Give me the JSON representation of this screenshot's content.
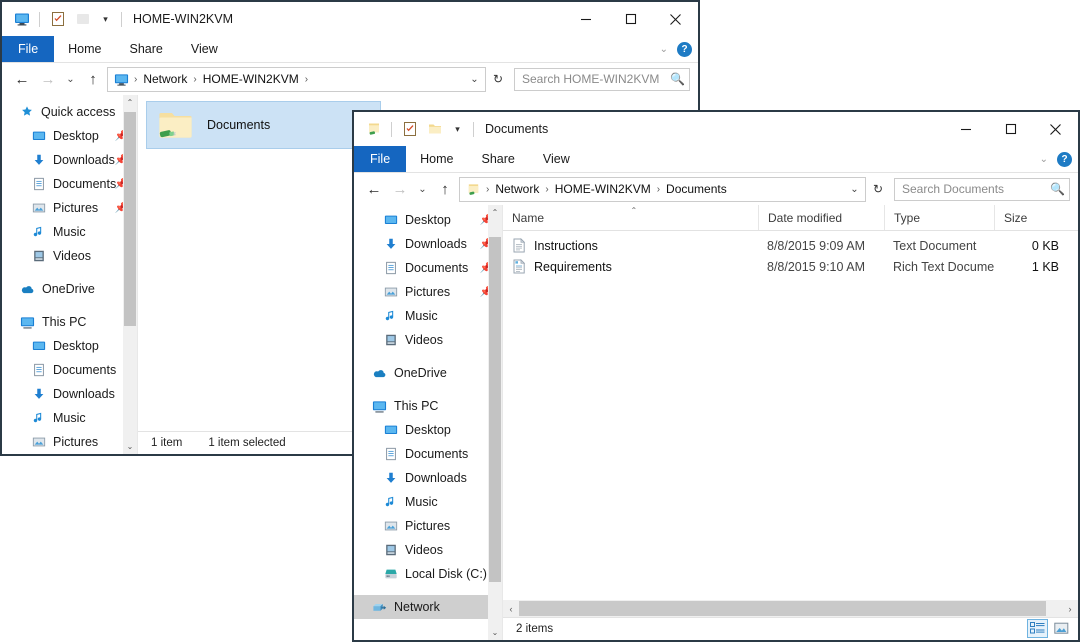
{
  "desktop": {
    "background_color": "#ffffff"
  },
  "windows": [
    {
      "id": "window-network-home",
      "title": "HOME-WIN2KVM",
      "quick_access_toolbar": {
        "computer_icon": "monitor-icon",
        "properties_icon": "properties-checklist-icon",
        "newfolder_icon": "new-folder-icon",
        "customize_icon": "chevron-down-icon"
      },
      "caption": {
        "minimize": "–",
        "maximize": "□",
        "close": "✕"
      },
      "ribbon": {
        "tabs": [
          "File",
          "Home",
          "Share",
          "View"
        ],
        "collapse_icon": "chevron-down-icon",
        "help_icon": "help-icon",
        "help_label": "?"
      },
      "address": {
        "back_icon": "arrow-left-icon",
        "forward_icon": "arrow-right-icon",
        "recent_icon": "chevron-down-icon",
        "up_icon": "arrow-up-icon",
        "root_icon": "monitor-icon",
        "crumbs": [
          "Network",
          "HOME-WIN2KVM"
        ],
        "trailing_separator": "›",
        "dropdown_icon": "chevron-down-icon",
        "refresh_icon": "refresh-icon",
        "refresh_label": "↻"
      },
      "search": {
        "placeholder": "Search HOME-WIN2KVM",
        "icon": "search-icon"
      },
      "nav_pane": {
        "groups": [
          {
            "header": {
              "label": "Quick access",
              "icon": "star-pin-icon"
            },
            "items": [
              {
                "label": "Desktop",
                "icon": "desktop-icon",
                "pinned": true
              },
              {
                "label": "Downloads",
                "icon": "downloads-icon",
                "pinned": true
              },
              {
                "label": "Documents",
                "icon": "documents-icon",
                "pinned": true
              },
              {
                "label": "Pictures",
                "icon": "pictures-icon",
                "pinned": true
              },
              {
                "label": "Music",
                "icon": "music-icon",
                "pinned": false
              },
              {
                "label": "Videos",
                "icon": "videos-icon",
                "pinned": false
              }
            ]
          },
          {
            "header": {
              "label": "OneDrive",
              "icon": "onedrive-cloud-icon"
            },
            "items": []
          },
          {
            "header": {
              "label": "This PC",
              "icon": "thispc-monitor-icon"
            },
            "items": [
              {
                "label": "Desktop",
                "icon": "desktop-icon",
                "pinned": false
              },
              {
                "label": "Documents",
                "icon": "documents-icon",
                "pinned": false
              },
              {
                "label": "Downloads",
                "icon": "downloads-icon",
                "pinned": false
              },
              {
                "label": "Music",
                "icon": "music-icon",
                "pinned": false
              },
              {
                "label": "Pictures",
                "icon": "pictures-icon",
                "pinned": false
              }
            ]
          }
        ],
        "scroll_up_icon": "chevron-up-icon",
        "scroll_down_icon": "chevron-down-icon"
      },
      "files": [
        {
          "name": "Documents",
          "icon": "shared-folder-icon",
          "selected": true
        }
      ],
      "status": {
        "count": "1 item",
        "selection": "1 item selected"
      }
    },
    {
      "id": "window-documents",
      "title": "Documents",
      "quick_access_toolbar": {
        "computer_icon": "shared-folder-icon",
        "properties_icon": "properties-checklist-icon",
        "newfolder_icon": "new-folder-icon",
        "customize_icon": "chevron-down-icon"
      },
      "caption": {
        "minimize": "–",
        "maximize": "□",
        "close": "✕"
      },
      "ribbon": {
        "tabs": [
          "File",
          "Home",
          "Share",
          "View"
        ],
        "collapse_icon": "chevron-down-icon",
        "help_icon": "help-icon",
        "help_label": "?"
      },
      "address": {
        "back_icon": "arrow-left-icon",
        "forward_icon": "arrow-right-icon",
        "recent_icon": "chevron-down-icon",
        "up_icon": "arrow-up-icon",
        "root_icon": "shared-folder-icon",
        "crumbs": [
          "Network",
          "HOME-WIN2KVM",
          "Documents"
        ],
        "trailing_separator": "",
        "dropdown_icon": "chevron-down-icon",
        "refresh_icon": "refresh-icon",
        "refresh_label": "↻"
      },
      "search": {
        "placeholder": "Search Documents",
        "icon": "search-icon"
      },
      "nav_pane": {
        "groups": [
          {
            "header": null,
            "items": [
              {
                "label": "Desktop",
                "icon": "desktop-icon",
                "pinned": true
              },
              {
                "label": "Downloads",
                "icon": "downloads-icon",
                "pinned": true
              },
              {
                "label": "Documents",
                "icon": "documents-icon",
                "pinned": true
              },
              {
                "label": "Pictures",
                "icon": "pictures-icon",
                "pinned": true
              },
              {
                "label": "Music",
                "icon": "music-icon",
                "pinned": false
              },
              {
                "label": "Videos",
                "icon": "videos-icon",
                "pinned": false
              }
            ]
          },
          {
            "header": {
              "label": "OneDrive",
              "icon": "onedrive-cloud-icon"
            },
            "items": []
          },
          {
            "header": {
              "label": "This PC",
              "icon": "thispc-monitor-icon"
            },
            "items": [
              {
                "label": "Desktop",
                "icon": "desktop-icon",
                "pinned": false
              },
              {
                "label": "Documents",
                "icon": "documents-icon",
                "pinned": false
              },
              {
                "label": "Downloads",
                "icon": "downloads-icon",
                "pinned": false
              },
              {
                "label": "Music",
                "icon": "music-icon",
                "pinned": false
              },
              {
                "label": "Pictures",
                "icon": "pictures-icon",
                "pinned": false
              },
              {
                "label": "Videos",
                "icon": "videos-icon",
                "pinned": false
              },
              {
                "label": "Local Disk (C:)",
                "icon": "local-disk-icon",
                "pinned": false
              }
            ]
          },
          {
            "header": {
              "label": "Network",
              "icon": "network-icon",
              "selected": true
            },
            "items": []
          }
        ],
        "scroll_up_icon": "chevron-up-icon",
        "scroll_down_icon": "chevron-down-icon"
      },
      "columns": [
        {
          "label": "Name",
          "sorted": true,
          "sort_icon": "chevron-up-icon"
        },
        {
          "label": "Date modified",
          "sorted": false
        },
        {
          "label": "Type",
          "sorted": false
        },
        {
          "label": "Size",
          "sorted": false
        }
      ],
      "rows": [
        {
          "name": "Instructions",
          "icon": "text-document-icon",
          "date_modified": "8/8/2015 9:09 AM",
          "type": "Text Document",
          "size": "0 KB"
        },
        {
          "name": "Requirements",
          "icon": "rich-text-document-icon",
          "date_modified": "8/8/2015 9:10 AM",
          "type": "Rich Text Document",
          "size": "1 KB"
        }
      ],
      "hscroll": {
        "left_icon": "chevron-left-icon",
        "right_icon": "chevron-right-icon"
      },
      "status": {
        "count": "2 items",
        "view_details_icon": "details-view-icon",
        "view_large_icon": "large-icons-view-icon"
      }
    }
  ]
}
